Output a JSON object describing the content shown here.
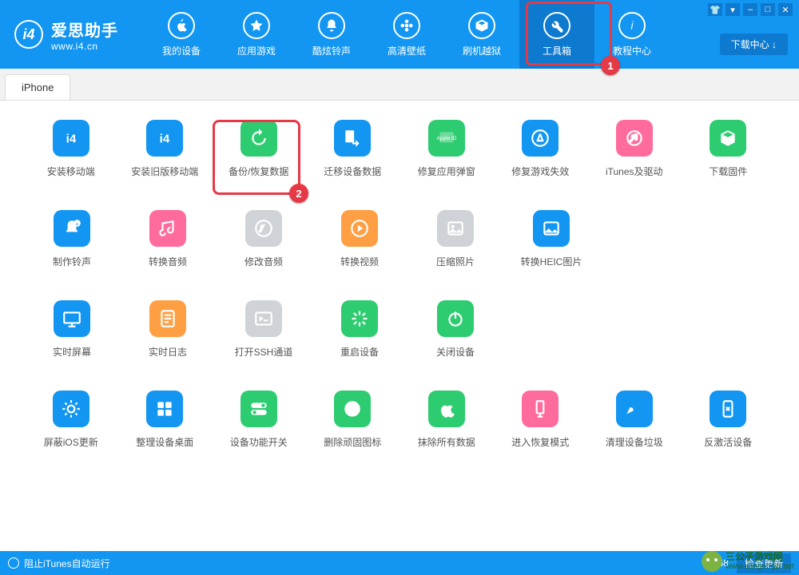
{
  "brand": {
    "name": "爱思助手",
    "url": "www.i4.cn",
    "badge": "i4"
  },
  "window_controls": {
    "shirt": "👕",
    "dropdown": "▾",
    "min": "–",
    "max": "□",
    "close": "✕"
  },
  "download_center": "下载中心 ↓",
  "nav": [
    {
      "label": "我的设备"
    },
    {
      "label": "应用游戏"
    },
    {
      "label": "酷炫铃声"
    },
    {
      "label": "高清壁纸"
    },
    {
      "label": "刷机越狱"
    },
    {
      "label": "工具箱"
    },
    {
      "label": "教程中心"
    }
  ],
  "tab": "iPhone",
  "annotations": {
    "one": "1",
    "two": "2"
  },
  "tools": {
    "row1": [
      {
        "label": "安装移动端",
        "color": "c-blue"
      },
      {
        "label": "安装旧版移动端",
        "color": "c-blue"
      },
      {
        "label": "备份/恢复数据",
        "color": "c-green"
      },
      {
        "label": "迁移设备数据",
        "color": "c-blue"
      },
      {
        "label": "修复应用弹窗",
        "color": "c-green"
      },
      {
        "label": "修复游戏失效",
        "color": "c-blue"
      },
      {
        "label": "iTunes及驱动",
        "color": "c-pink"
      },
      {
        "label": "下载固件",
        "color": "c-green"
      }
    ],
    "row2": [
      {
        "label": "制作铃声",
        "color": "c-blue"
      },
      {
        "label": "转换音频",
        "color": "c-pink"
      },
      {
        "label": "修改音频",
        "color": "c-gray"
      },
      {
        "label": "转换视频",
        "color": "c-orange"
      },
      {
        "label": "压缩照片",
        "color": "c-gray"
      },
      {
        "label": "转换HEIC图片",
        "color": "c-blue"
      }
    ],
    "row3": [
      {
        "label": "实时屏幕",
        "color": "c-blue"
      },
      {
        "label": "实时日志",
        "color": "c-orange"
      },
      {
        "label": "打开SSH通道",
        "color": "c-gray"
      },
      {
        "label": "重启设备",
        "color": "c-green"
      },
      {
        "label": "关闭设备",
        "color": "c-green"
      }
    ],
    "row4": [
      {
        "label": "屏蔽iOS更新",
        "color": "c-blue"
      },
      {
        "label": "整理设备桌面",
        "color": "c-blue"
      },
      {
        "label": "设备功能开关",
        "color": "c-green"
      },
      {
        "label": "删除顽固图标",
        "color": "c-green"
      },
      {
        "label": "抹除所有数据",
        "color": "c-green"
      },
      {
        "label": "进入恢复模式",
        "color": "c-pink"
      },
      {
        "label": "清理设备垃圾",
        "color": "c-blue"
      },
      {
        "label": "反激活设备",
        "color": "c-blue"
      }
    ]
  },
  "bottom": {
    "block_itunes": "阻止iTunes自动运行",
    "version": "V7.68",
    "check_update": "检查更新"
  },
  "watermark": "三公子游戏网\nwww.sangongzi.net"
}
